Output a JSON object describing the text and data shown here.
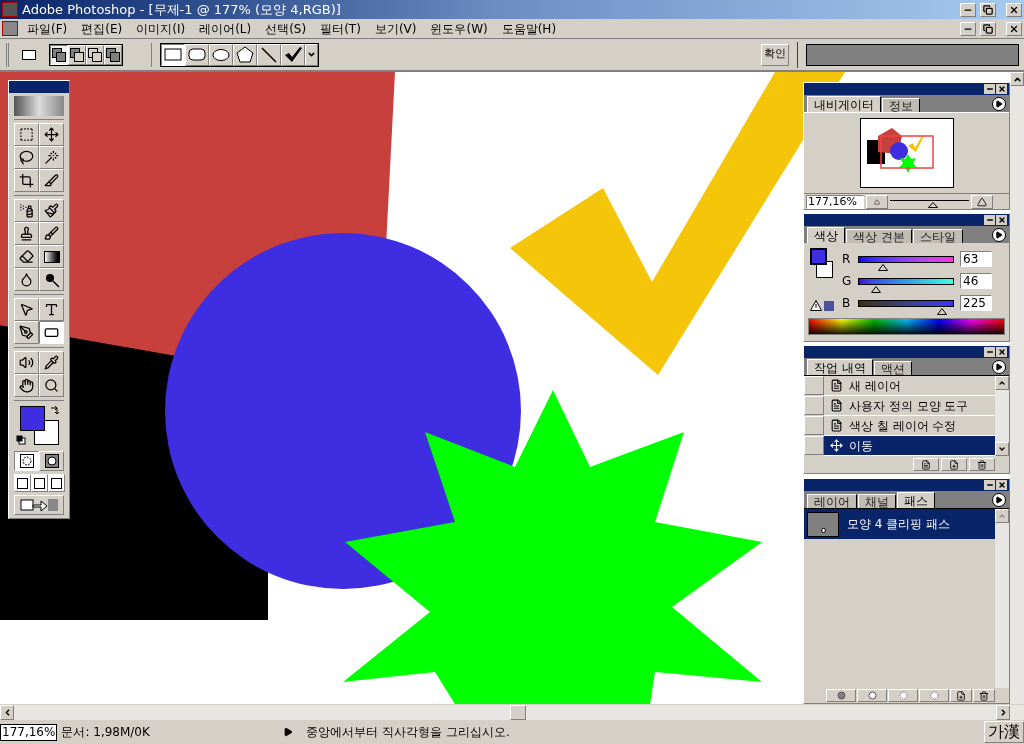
{
  "window": {
    "title": "Adobe Photoshop - [무제-1 @ 177% (모양 4,RGB)]"
  },
  "menu": [
    {
      "label": "파일(F)"
    },
    {
      "label": "편집(E)"
    },
    {
      "label": "이미지(I)"
    },
    {
      "label": "레이어(L)"
    },
    {
      "label": "선택(S)"
    },
    {
      "label": "필터(T)"
    },
    {
      "label": "보기(V)"
    },
    {
      "label": "윈도우(W)"
    },
    {
      "label": "도움말(H)"
    }
  ],
  "options_bar": {
    "modes": [
      {
        "kind": "add",
        "selected": true
      },
      {
        "kind": "subtract",
        "selected": false
      },
      {
        "kind": "intersect",
        "selected": false
      },
      {
        "kind": "exclude",
        "selected": false
      }
    ],
    "shapes": [
      {
        "kind": "rectangle",
        "selected": true
      },
      {
        "kind": "rounded",
        "selected": false
      },
      {
        "kind": "ellipse",
        "selected": false
      },
      {
        "kind": "polygon",
        "selected": false
      },
      {
        "kind": "line",
        "selected": false
      },
      {
        "kind": "custom",
        "selected": false
      }
    ],
    "confirm_button": "확인"
  },
  "toolbox": {
    "tools": [
      {
        "kind": "marquee",
        "selected": false
      },
      {
        "kind": "move",
        "selected": false
      },
      {
        "kind": "lasso",
        "selected": false
      },
      {
        "kind": "wand",
        "selected": false
      },
      {
        "kind": "crop",
        "selected": false
      },
      {
        "kind": "slice",
        "selected": false
      },
      {
        "kind": "airbrush",
        "selected": false
      },
      {
        "kind": "brush",
        "selected": false
      },
      {
        "kind": "stamp",
        "selected": false
      },
      {
        "kind": "history_brush",
        "selected": false
      },
      {
        "kind": "eraser",
        "selected": false
      },
      {
        "kind": "gradient",
        "selected": false
      },
      {
        "kind": "blur",
        "selected": false
      },
      {
        "kind": "dodge",
        "selected": false
      },
      {
        "kind": "path_select",
        "selected": false
      },
      {
        "kind": "type",
        "selected": false
      },
      {
        "kind": "pen",
        "selected": false
      },
      {
        "kind": "shape",
        "selected": true
      },
      {
        "kind": "notes",
        "selected": false
      },
      {
        "kind": "eyedropper",
        "selected": false
      },
      {
        "kind": "hand",
        "selected": false
      },
      {
        "kind": "zoom",
        "selected": false
      }
    ],
    "mask_modes": [
      {
        "selected": true
      },
      {
        "selected": false
      }
    ]
  },
  "navigator": {
    "tabs": [
      {
        "label": "내비게이터",
        "selected": true
      },
      {
        "label": "정보",
        "selected": false
      }
    ],
    "zoom": "177,16%",
    "zoom_slider": {
      "level": 0.55
    }
  },
  "color": {
    "tabs": [
      {
        "label": "색상",
        "selected": true
      },
      {
        "label": "색상 견본",
        "selected": false
      },
      {
        "label": "스타일",
        "selected": false
      }
    ],
    "channels": [
      {
        "label": "R",
        "value": "63",
        "level": 0.25
      },
      {
        "label": "G",
        "value": "46",
        "level": 0.18
      },
      {
        "label": "B",
        "value": "225",
        "level": 0.88
      }
    ]
  },
  "history": {
    "tabs": [
      {
        "label": "작업 내역",
        "selected": true
      },
      {
        "label": "액션",
        "selected": false
      }
    ],
    "items": [
      {
        "label": "새 레이어",
        "selected": false,
        "snapshot": false
      },
      {
        "label": "사용자 정의 모양 도구",
        "selected": false,
        "snapshot": false
      },
      {
        "label": "색상 칠 레이어 수정",
        "selected": false,
        "snapshot": false
      },
      {
        "label": "이동",
        "selected": true,
        "snapshot": false
      }
    ]
  },
  "paths": {
    "tabs": [
      {
        "label": "레이어",
        "selected": false
      },
      {
        "label": "채널",
        "selected": false
      },
      {
        "label": "패스",
        "selected": true
      }
    ],
    "items": [
      {
        "label": "모양 4 클리핑 패스",
        "selected": true
      }
    ]
  },
  "status_bar": {
    "zoom": "177,16%",
    "document": "문서: 1,98M/0K",
    "hint": "중앙에서부터 직사각형을 그리십시오.",
    "ime": "가漢"
  }
}
